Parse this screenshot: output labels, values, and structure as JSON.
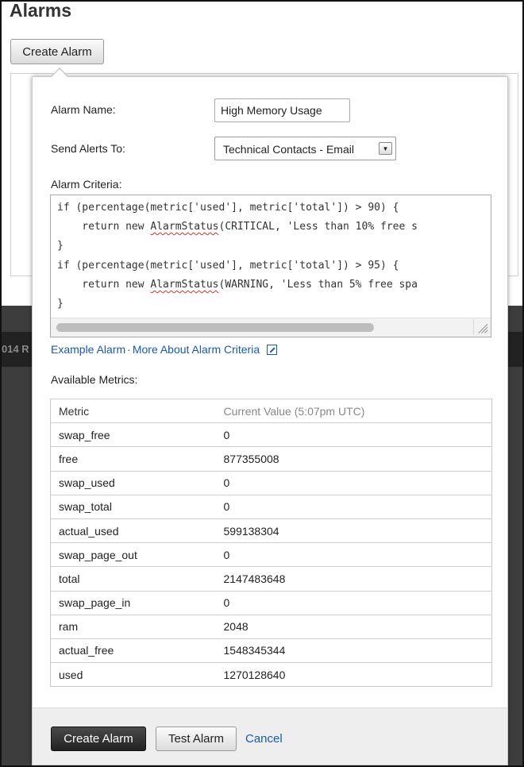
{
  "page": {
    "title": "Alarms",
    "create_button": "Create Alarm",
    "background_bar_text": "014 R"
  },
  "modal": {
    "alarm_name_label": "Alarm Name:",
    "alarm_name_value": "High Memory Usage",
    "send_alerts_label": "Send Alerts To:",
    "send_alerts_value": "Technical Contacts - Email",
    "criteria_label": "Alarm Criteria:",
    "criteria_code": [
      {
        "before": "if (percentage(metric['used'], metric['total']) > 90) {",
        "squig": "",
        "after": ""
      },
      {
        "before": "    return new ",
        "squig": "AlarmStatus",
        "after": "(CRITICAL, 'Less than 10% free s"
      },
      {
        "before": "}",
        "squig": "",
        "after": ""
      },
      {
        "before": "if (percentage(metric['used'], metric['total']) > 95) {",
        "squig": "",
        "after": ""
      },
      {
        "before": "    return new ",
        "squig": "AlarmStatus",
        "after": "(WARNING, 'Less than 5% free spa"
      },
      {
        "before": "}",
        "squig": "",
        "after": ""
      }
    ],
    "example_link": "Example Alarm",
    "separator": "·",
    "more_link": "More About Alarm Criteria",
    "metrics_label": "Available Metrics:",
    "metrics_table": {
      "header_metric": "Metric",
      "header_value": "Current Value (5:07pm UTC)",
      "rows": [
        {
          "metric": "swap_free",
          "value": "0"
        },
        {
          "metric": "free",
          "value": "877355008"
        },
        {
          "metric": "swap_used",
          "value": "0"
        },
        {
          "metric": "swap_total",
          "value": "0"
        },
        {
          "metric": "actual_used",
          "value": "599138304"
        },
        {
          "metric": "swap_page_out",
          "value": "0"
        },
        {
          "metric": "total",
          "value": "2147483648"
        },
        {
          "metric": "swap_page_in",
          "value": "0"
        },
        {
          "metric": "ram",
          "value": "2048"
        },
        {
          "metric": "actual_free",
          "value": "1548345344"
        },
        {
          "metric": "used",
          "value": "1270128640"
        }
      ]
    },
    "footer": {
      "create_label": "Create Alarm",
      "test_label": "Test Alarm",
      "cancel_label": "Cancel"
    }
  },
  "icons": {
    "select_arrow": "chevron-down-icon",
    "external_link": "external-link-icon",
    "resize_grip": "resize-grip-icon"
  },
  "colors": {
    "link": "#1a5aa6",
    "primary_button": "#2f2f2f",
    "page_background_dark": "#3d3d3d"
  }
}
